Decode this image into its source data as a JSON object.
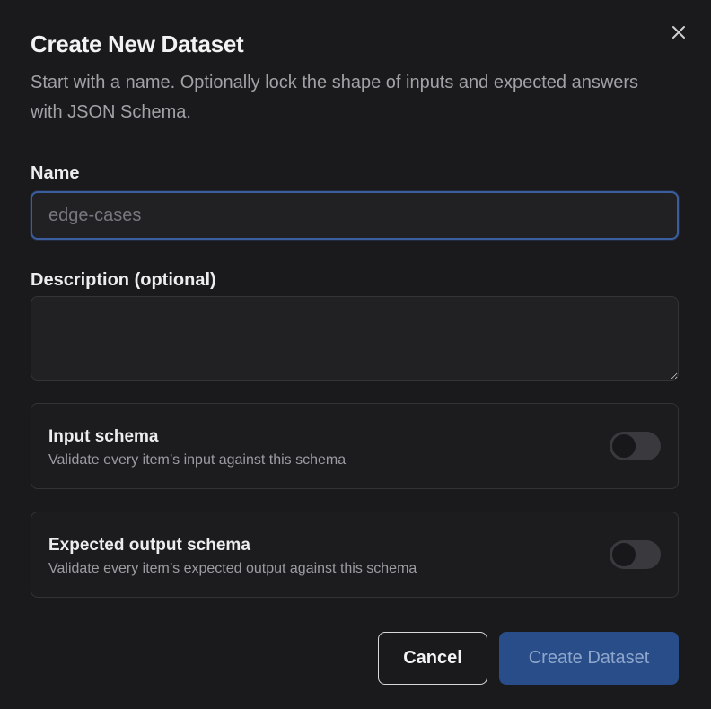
{
  "dialog": {
    "title": "Create New Dataset",
    "subtitle": "Start with a name. Optionally lock the shape of inputs and expected answers with JSON Schema.",
    "close_icon": "close-icon"
  },
  "name_field": {
    "label": "Name",
    "placeholder": "edge-cases",
    "value": ""
  },
  "description_field": {
    "label": "Description (optional)",
    "value": ""
  },
  "input_schema": {
    "title": "Input schema",
    "description": "Validate every item’s input against this schema",
    "enabled": false
  },
  "output_schema": {
    "title": "Expected output schema",
    "description": "Validate every item’s expected output against this schema",
    "enabled": false
  },
  "actions": {
    "cancel_label": "Cancel",
    "create_label": "Create Dataset"
  },
  "colors": {
    "background": "#1a1a1c",
    "accent": "#284d88",
    "input_focus_border": "#3a5e9e",
    "toggle_off": "#3a3a3e"
  }
}
